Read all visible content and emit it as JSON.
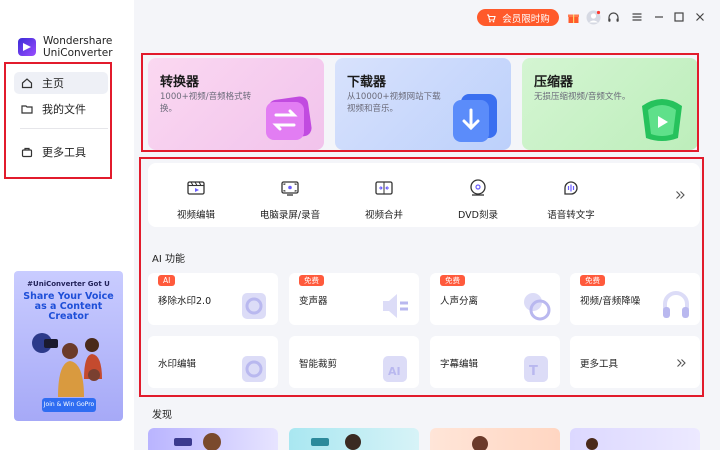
{
  "app": {
    "name_line1": "Wondershare",
    "name_line2": "UniConverter"
  },
  "sidebar": {
    "items": [
      {
        "label": "主页",
        "icon": "home-icon",
        "active": true
      },
      {
        "label": "我的文件",
        "icon": "folder-icon",
        "active": false
      },
      {
        "label": "更多工具",
        "icon": "toolbox-icon",
        "active": false
      }
    ]
  },
  "promo": {
    "tag": "#UniConverter Got U",
    "title": "Share Your Voice as a Content Creator",
    "button": "Join & Win GoPro"
  },
  "topbar": {
    "member_label": "会员限时购",
    "icons": [
      "gift-icon",
      "avatar-icon",
      "headset-icon",
      "menu-icon",
      "minimize-icon",
      "maximize-icon",
      "close-icon"
    ]
  },
  "big_cards": [
    {
      "title": "转换器",
      "desc": "1000+视频/音频格式转换。",
      "color": "#f6c6ec"
    },
    {
      "title": "下载器",
      "desc": "从10000+视频网站下载视频和音乐。",
      "color": "#c3d3fb"
    },
    {
      "title": "压缩器",
      "desc": "无损压缩视频/音频文件。",
      "color": "#c6f0c4"
    }
  ],
  "tools": [
    {
      "label": "视频编辑",
      "icon": "video-edit-icon"
    },
    {
      "label": "电脑录屏/录音",
      "icon": "screen-record-icon"
    },
    {
      "label": "视频合并",
      "icon": "merge-icon"
    },
    {
      "label": "DVD刻录",
      "icon": "dvd-icon"
    },
    {
      "label": "语音转文字",
      "icon": "speech-to-text-icon"
    }
  ],
  "ai_section": {
    "title": "AI 功能",
    "cards": [
      {
        "label": "移除水印2.0",
        "badge": "AI",
        "icon": "watermark-remove-icon"
      },
      {
        "label": "变声器",
        "badge": "免费",
        "icon": "voice-changer-icon"
      },
      {
        "label": "人声分离",
        "badge": "免费",
        "icon": "vocal-separate-icon"
      },
      {
        "label": "视频/音频降噪",
        "badge": "免费",
        "icon": "noise-reduction-icon"
      },
      {
        "label": "水印编辑",
        "badge": "",
        "icon": "watermark-edit-icon"
      },
      {
        "label": "智能裁剪",
        "badge": "",
        "icon": "smart-crop-icon"
      },
      {
        "label": "字幕编辑",
        "badge": "",
        "icon": "subtitle-edit-icon"
      },
      {
        "label": "更多工具",
        "badge": "",
        "icon": "chevron-right-icon"
      }
    ]
  },
  "discover": {
    "title": "发现"
  },
  "colors": {
    "accent": "#ff5a2b",
    "highlight": "#e21b2c"
  }
}
